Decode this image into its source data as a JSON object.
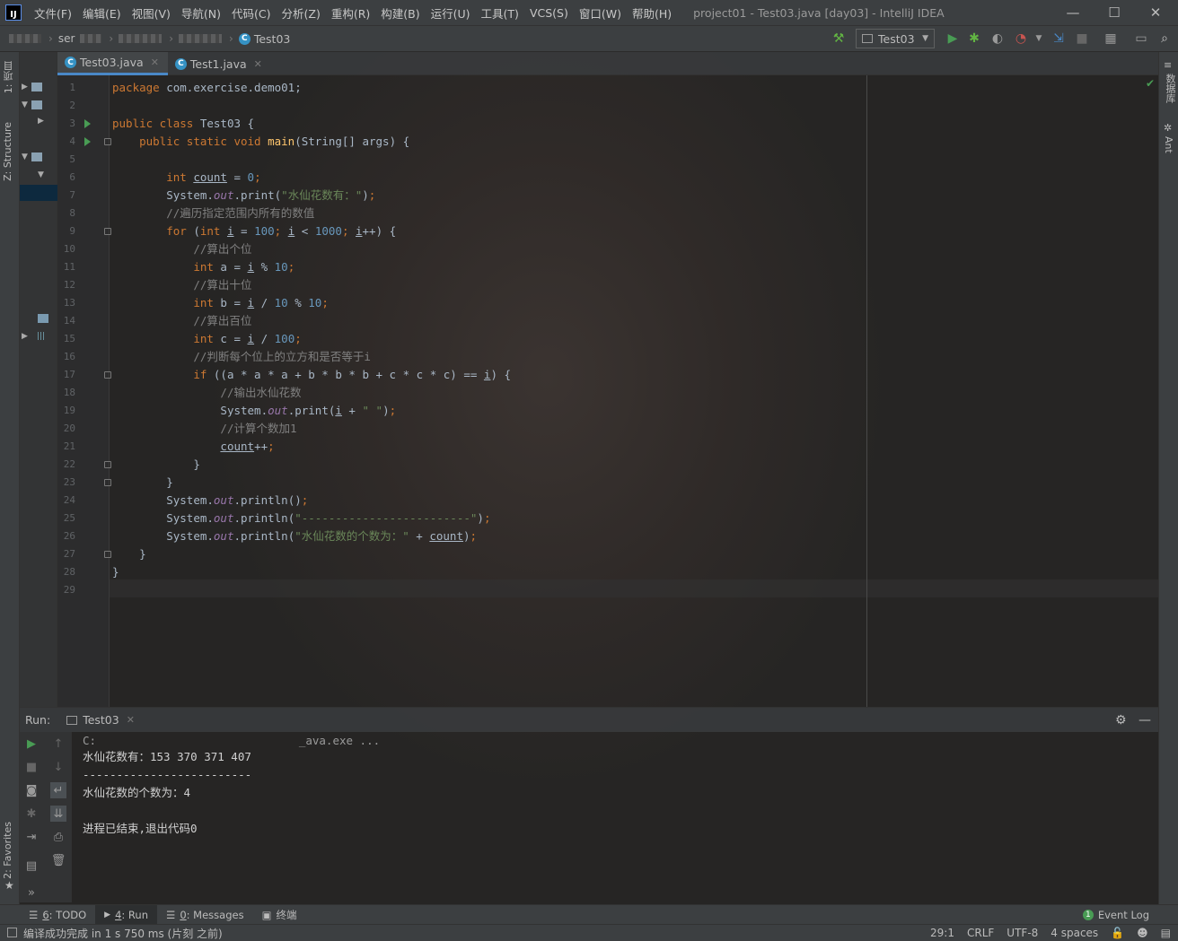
{
  "menubar": {
    "logo": "IJ",
    "items": [
      "文件(F)",
      "编辑(E)",
      "视图(V)",
      "导航(N)",
      "代码(C)",
      "分析(Z)",
      "重构(R)",
      "构建(B)",
      "运行(U)",
      "工具(T)",
      "VCS(S)",
      "窗口(W)",
      "帮助(H)"
    ],
    "title": "project01 - Test03.java [day03] - IntelliJ IDEA",
    "min": "—",
    "max": "☐",
    "close": "✕"
  },
  "navbar": {
    "crumbs": [
      "ser",
      "",
      "",
      "",
      ""
    ],
    "file": "Test03",
    "file_icon": "C",
    "run_config": "Test03"
  },
  "stripes": {
    "left_project": "1: 项目",
    "left_structure": "Z: Structure",
    "left_favorites": "2: Favorites",
    "right_database": "数据库",
    "right_ant": "Ant"
  },
  "tabs": [
    {
      "label": "Test03.java",
      "icon": "C"
    },
    {
      "label": "Test1.java",
      "icon": "C"
    }
  ],
  "tab_close": "✕",
  "editor": {
    "line_numbers": [
      "1",
      "2",
      "3",
      "4",
      "5",
      "6",
      "7",
      "8",
      "9",
      "10",
      "11",
      "12",
      "13",
      "14",
      "15",
      "16",
      "17",
      "18",
      "19",
      "20",
      "21",
      "22",
      "23",
      "24",
      "25",
      "26",
      "27",
      "28",
      "29"
    ],
    "lines": [
      {
        "indent": "",
        "parts": [
          {
            "t": "k",
            "v": "package "
          },
          {
            "t": "p",
            "v": "com.exercise.demo01;"
          }
        ]
      },
      {
        "indent": "",
        "parts": []
      },
      {
        "indent": "",
        "parts": [
          {
            "t": "k",
            "v": "public class "
          },
          {
            "t": "p",
            "v": "Test03 {"
          }
        ]
      },
      {
        "indent": "    ",
        "parts": [
          {
            "t": "k",
            "v": "public static void "
          },
          {
            "t": "m",
            "v": "main"
          },
          {
            "t": "p",
            "v": "(String[] args) {"
          }
        ]
      },
      {
        "indent": "",
        "parts": []
      },
      {
        "indent": "        ",
        "parts": [
          {
            "t": "k",
            "v": "int "
          },
          {
            "t": "u",
            "v": "count"
          },
          {
            "t": "p",
            "v": " = "
          },
          {
            "t": "n",
            "v": "0"
          },
          {
            "t": "k",
            "v": ";"
          }
        ]
      },
      {
        "indent": "        ",
        "parts": [
          {
            "t": "p",
            "v": "System."
          },
          {
            "t": "f",
            "v": "out"
          },
          {
            "t": "p",
            "v": ".print("
          },
          {
            "t": "s",
            "v": "\"水仙花数有：\""
          },
          {
            "t": "p",
            "v": ")"
          },
          {
            "t": "k",
            "v": ";"
          }
        ]
      },
      {
        "indent": "        ",
        "parts": [
          {
            "t": "c",
            "v": "//遍历指定范围内所有的数值"
          }
        ]
      },
      {
        "indent": "        ",
        "parts": [
          {
            "t": "k",
            "v": "for "
          },
          {
            "t": "p",
            "v": "("
          },
          {
            "t": "k",
            "v": "int "
          },
          {
            "t": "u",
            "v": "i"
          },
          {
            "t": "p",
            "v": " = "
          },
          {
            "t": "n",
            "v": "100"
          },
          {
            "t": "k",
            "v": "; "
          },
          {
            "t": "u",
            "v": "i"
          },
          {
            "t": "p",
            "v": " < "
          },
          {
            "t": "n",
            "v": "1000"
          },
          {
            "t": "k",
            "v": "; "
          },
          {
            "t": "u",
            "v": "i"
          },
          {
            "t": "p",
            "v": "++) {"
          }
        ]
      },
      {
        "indent": "            ",
        "parts": [
          {
            "t": "c",
            "v": "//算出个位"
          }
        ]
      },
      {
        "indent": "            ",
        "parts": [
          {
            "t": "k",
            "v": "int "
          },
          {
            "t": "p",
            "v": "a = "
          },
          {
            "t": "u",
            "v": "i"
          },
          {
            "t": "p",
            "v": " % "
          },
          {
            "t": "n",
            "v": "10"
          },
          {
            "t": "k",
            "v": ";"
          }
        ]
      },
      {
        "indent": "            ",
        "parts": [
          {
            "t": "c",
            "v": "//算出十位"
          }
        ]
      },
      {
        "indent": "            ",
        "parts": [
          {
            "t": "k",
            "v": "int "
          },
          {
            "t": "p",
            "v": "b = "
          },
          {
            "t": "u",
            "v": "i"
          },
          {
            "t": "p",
            "v": " / "
          },
          {
            "t": "n",
            "v": "10"
          },
          {
            "t": "p",
            "v": " % "
          },
          {
            "t": "n",
            "v": "10"
          },
          {
            "t": "k",
            "v": ";"
          }
        ]
      },
      {
        "indent": "            ",
        "parts": [
          {
            "t": "c",
            "v": "//算出百位"
          }
        ]
      },
      {
        "indent": "            ",
        "parts": [
          {
            "t": "k",
            "v": "int "
          },
          {
            "t": "p",
            "v": "c = "
          },
          {
            "t": "u",
            "v": "i"
          },
          {
            "t": "p",
            "v": " / "
          },
          {
            "t": "n",
            "v": "100"
          },
          {
            "t": "k",
            "v": ";"
          }
        ]
      },
      {
        "indent": "            ",
        "parts": [
          {
            "t": "c",
            "v": "//判断每个位上的立方和是否等于i"
          }
        ]
      },
      {
        "indent": "            ",
        "parts": [
          {
            "t": "k",
            "v": "if "
          },
          {
            "t": "p",
            "v": "((a * a * a + b * b * b + c * c * c) == "
          },
          {
            "t": "u",
            "v": "i"
          },
          {
            "t": "p",
            "v": ") {"
          }
        ]
      },
      {
        "indent": "                ",
        "parts": [
          {
            "t": "c",
            "v": "//输出水仙花数"
          }
        ]
      },
      {
        "indent": "                ",
        "parts": [
          {
            "t": "p",
            "v": "System."
          },
          {
            "t": "f",
            "v": "out"
          },
          {
            "t": "p",
            "v": ".print("
          },
          {
            "t": "u",
            "v": "i"
          },
          {
            "t": "p",
            "v": " + "
          },
          {
            "t": "s",
            "v": "\" \""
          },
          {
            "t": "p",
            "v": ")"
          },
          {
            "t": "k",
            "v": ";"
          }
        ]
      },
      {
        "indent": "                ",
        "parts": [
          {
            "t": "c",
            "v": "//计算个数加1"
          }
        ]
      },
      {
        "indent": "                ",
        "parts": [
          {
            "t": "u",
            "v": "count"
          },
          {
            "t": "p",
            "v": "++"
          },
          {
            "t": "k",
            "v": ";"
          }
        ]
      },
      {
        "indent": "            ",
        "parts": [
          {
            "t": "p",
            "v": "}"
          }
        ]
      },
      {
        "indent": "        ",
        "parts": [
          {
            "t": "p",
            "v": "}"
          }
        ]
      },
      {
        "indent": "        ",
        "parts": [
          {
            "t": "p",
            "v": "System."
          },
          {
            "t": "f",
            "v": "out"
          },
          {
            "t": "p",
            "v": ".println()"
          },
          {
            "t": "k",
            "v": ";"
          }
        ]
      },
      {
        "indent": "        ",
        "parts": [
          {
            "t": "p",
            "v": "System."
          },
          {
            "t": "f",
            "v": "out"
          },
          {
            "t": "p",
            "v": ".println("
          },
          {
            "t": "s",
            "v": "\"-------------------------\""
          },
          {
            "t": "p",
            "v": ")"
          },
          {
            "t": "k",
            "v": ";"
          }
        ]
      },
      {
        "indent": "        ",
        "parts": [
          {
            "t": "p",
            "v": "System."
          },
          {
            "t": "f",
            "v": "out"
          },
          {
            "t": "p",
            "v": ".println("
          },
          {
            "t": "s",
            "v": "\"水仙花数的个数为：\""
          },
          {
            "t": "p",
            "v": " + "
          },
          {
            "t": "u",
            "v": "count"
          },
          {
            "t": "p",
            "v": ")"
          },
          {
            "t": "k",
            "v": ";"
          }
        ]
      },
      {
        "indent": "    ",
        "parts": [
          {
            "t": "p",
            "v": "}"
          }
        ]
      },
      {
        "indent": "",
        "parts": [
          {
            "t": "p",
            "v": "}"
          }
        ]
      },
      {
        "indent": "",
        "parts": []
      }
    ]
  },
  "run_panel": {
    "title": "Run:",
    "tab": "Test03",
    "console": [
      "C:                              _ava.exe ...",
      "水仙花数有：153 370 371 407",
      "-------------------------",
      "水仙花数的个数为：4",
      "",
      "进程已结束,退出代码0"
    ]
  },
  "bottom_tabs": [
    {
      "key": "6",
      "label": ": TODO",
      "icon": "☰"
    },
    {
      "key": "4",
      "label": ": Run",
      "icon": "▶"
    },
    {
      "key": "0",
      "label": ": Messages",
      "icon": "☰"
    },
    {
      "key": "",
      "label": "终端",
      "icon": "▣"
    }
  ],
  "event_log": {
    "count": "1",
    "label": "Event Log"
  },
  "status": {
    "message": "编译成功完成 in 1 s 750 ms (片刻 之前)",
    "position": "29:1",
    "line_sep": "CRLF",
    "encoding": "UTF-8",
    "indent": "4 spaces"
  },
  "colors": {
    "accent": "#4a88c7",
    "run_green": "#499c54",
    "debug_green": "#62b543"
  }
}
